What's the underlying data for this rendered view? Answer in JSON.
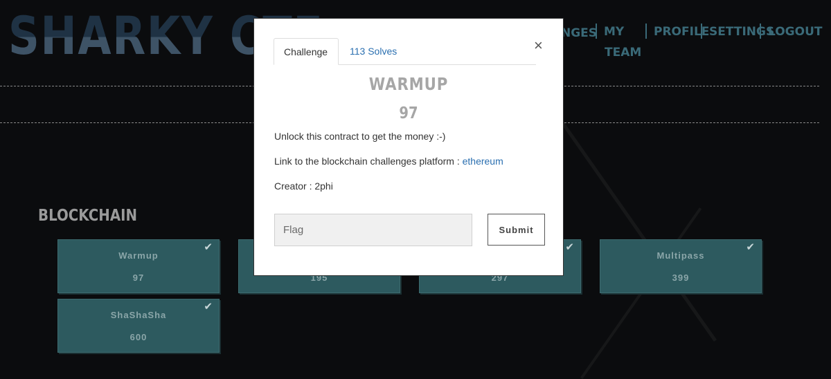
{
  "site": {
    "logo": "SHARKY CTF"
  },
  "nav": {
    "challenges_partial": "NGES",
    "my_team_line1": "MY",
    "my_team_line2": "TEAM",
    "profile": "PROFILE",
    "settings": "SETTINGS",
    "logout": "LOGOUT"
  },
  "category": {
    "title": "BLOCKCHAIN",
    "cards": [
      {
        "name": "Warmup",
        "value": "97",
        "solved": true
      },
      {
        "name": "",
        "value": "195",
        "solved": true
      },
      {
        "name": "",
        "value": "297",
        "solved": true
      },
      {
        "name": "Multipass",
        "value": "399",
        "solved": true
      },
      {
        "name": "ShaShaSha",
        "value": "600",
        "solved": true
      }
    ],
    "check_glyph": "✔"
  },
  "modal": {
    "tabs": {
      "challenge": "Challenge",
      "solves": "113 Solves"
    },
    "close_glyph": "×",
    "title": "WARMUP",
    "points": "97",
    "description": "Unlock this contract to get the money :-)",
    "link_prefix": "Link to the blockchain challenges platform : ",
    "link_text": "ethereum",
    "creator": "Creator : 2phi",
    "flag_placeholder": "Flag",
    "submit_label": "Submit"
  },
  "colors": {
    "background": "#0b0c0e",
    "card": "#2d5a5f",
    "nav": "#3a6a78",
    "link": "#2a6fb0"
  }
}
